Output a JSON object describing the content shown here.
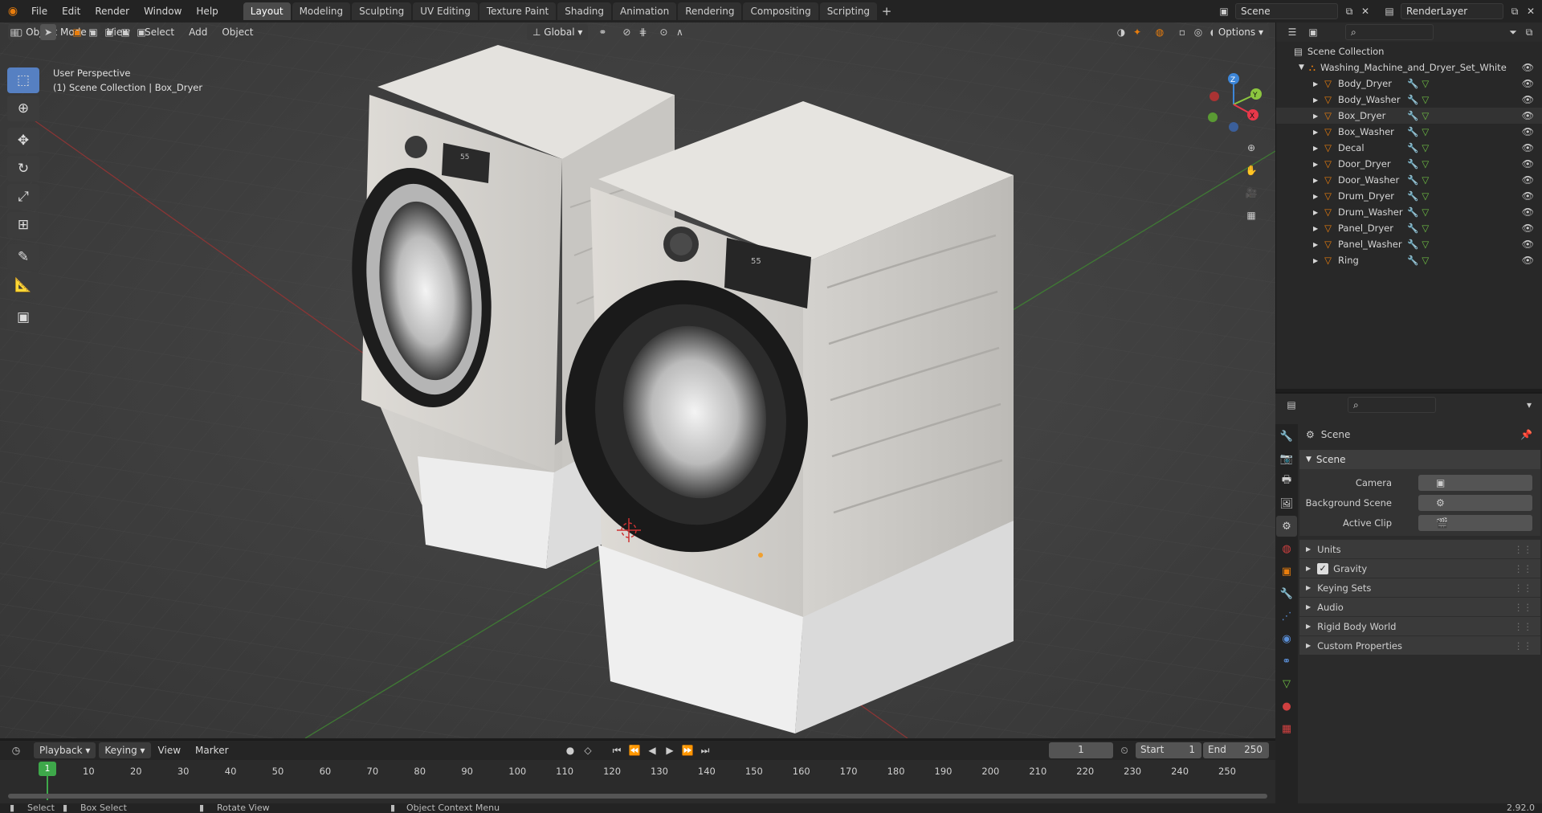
{
  "menu": [
    "File",
    "Edit",
    "Render",
    "Window",
    "Help"
  ],
  "workspaces": [
    "Layout",
    "Modeling",
    "Sculpting",
    "UV Editing",
    "Texture Paint",
    "Shading",
    "Animation",
    "Rendering",
    "Compositing",
    "Scripting"
  ],
  "active_workspace": "Layout",
  "add_tab": "+",
  "scene_name": "Scene",
  "render_layer": "RenderLayer",
  "viewport": {
    "mode": "Object Mode",
    "menus": [
      "View",
      "Select",
      "Add",
      "Object"
    ],
    "transform_orientation": "Global",
    "options": "Options",
    "overlay_title": "User Perspective",
    "overlay_sub": "(1) Scene Collection | Box_Dryer",
    "axes": {
      "z": "Z",
      "y": "Y",
      "x": "X"
    },
    "panel_labels": {
      "washer": "55",
      "dryer": "55"
    }
  },
  "outliner": {
    "root": "Scene Collection",
    "collection": "Washing_Machine_and_Dryer_Set_White",
    "objects": [
      "Body_Dryer",
      "Body_Washer",
      "Box_Dryer",
      "Box_Washer",
      "Decal",
      "Door_Dryer",
      "Door_Washer",
      "Drum_Dryer",
      "Drum_Washer",
      "Panel_Dryer",
      "Panel_Washer",
      "Ring"
    ]
  },
  "properties": {
    "context": "Scene",
    "panel": "Scene",
    "fields": [
      {
        "label": "Camera"
      },
      {
        "label": "Background Scene"
      },
      {
        "label": "Active Clip"
      }
    ],
    "subpanels": [
      "Units",
      "Gravity",
      "Keying Sets",
      "Audio",
      "Rigid Body World",
      "Custom Properties"
    ],
    "gravity_checked": true
  },
  "timeline": {
    "menus": [
      "Playback",
      "Keying",
      "View",
      "Marker"
    ],
    "current_frame": "1",
    "start_label": "Start",
    "start": "1",
    "end_label": "End",
    "end": "250",
    "ticks": [
      "10",
      "20",
      "30",
      "40",
      "50",
      "60",
      "70",
      "80",
      "90",
      "100",
      "110",
      "120",
      "130",
      "140",
      "150",
      "160",
      "170",
      "180",
      "190",
      "200",
      "210",
      "220",
      "230",
      "240",
      "250"
    ],
    "playhead_label": "1"
  },
  "status": {
    "select": "Select",
    "box_select": "Box Select",
    "rotate": "Rotate View",
    "context_menu": "Object Context Menu",
    "version": "2.92.0"
  },
  "colors": {
    "accent": "#5680c2",
    "orange": "#e87d0d",
    "axis_x": "#e8384a",
    "axis_y": "#8cc63f",
    "axis_z": "#3d86d8",
    "playhead": "#3ea84a"
  }
}
